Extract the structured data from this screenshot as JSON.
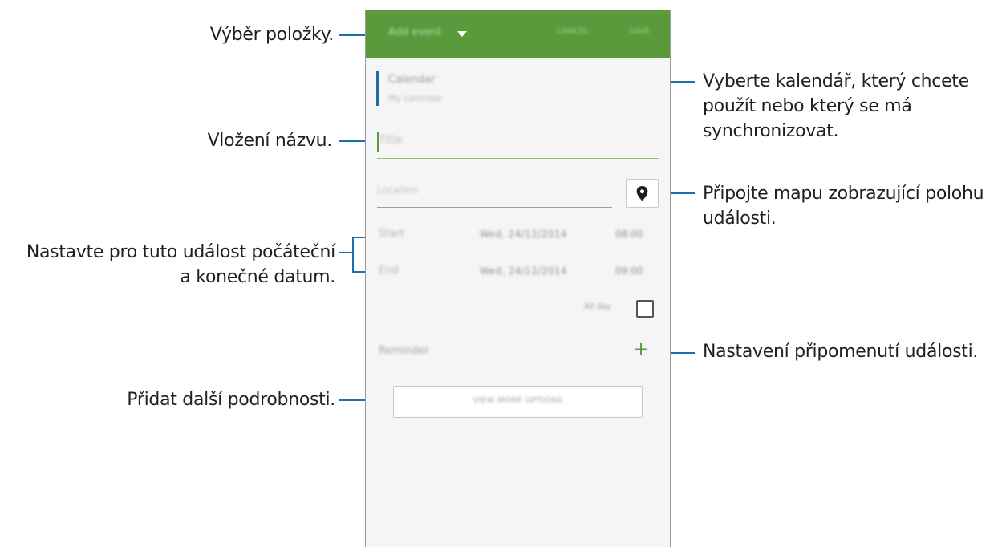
{
  "annotations": {
    "select_item": "Výběr položky.",
    "insert_title": "Vložení názvu.",
    "set_dates_line1": "Nastavte pro tuto událost počáteční",
    "set_dates_line2": "a konečné datum.",
    "add_details": "Přidat další podrobnosti.",
    "calendar_line1": "Vyberte kalendář, který chcete",
    "calendar_line2": "použít nebo který se má",
    "calendar_line3": "synchronizovat.",
    "map_line1": "Připojte mapu zobrazující polohu",
    "map_line2": "události.",
    "reminder": "Nastavení připomenutí události."
  },
  "app": {
    "topbar": {
      "selector": "Add event",
      "cancel": "CANCEL",
      "save": "SAVE",
      "color": "#5a9a3c"
    },
    "calendar": {
      "name": "Calendar",
      "account": "My calendar"
    },
    "title_placeholder": "Title",
    "location_placeholder": "Location",
    "start": {
      "label": "Start",
      "date": "Wed, 24/12/2014",
      "time": "08:00"
    },
    "end": {
      "label": "End",
      "date": "Wed, 24/12/2014",
      "time": "09:00"
    },
    "all_day": {
      "label": "All day",
      "checked": false
    },
    "reminder": {
      "label": "Reminder",
      "add_symbol": "+"
    },
    "more_options": "VIEW MORE OPTIONS",
    "accent": "#1b6fa8"
  }
}
